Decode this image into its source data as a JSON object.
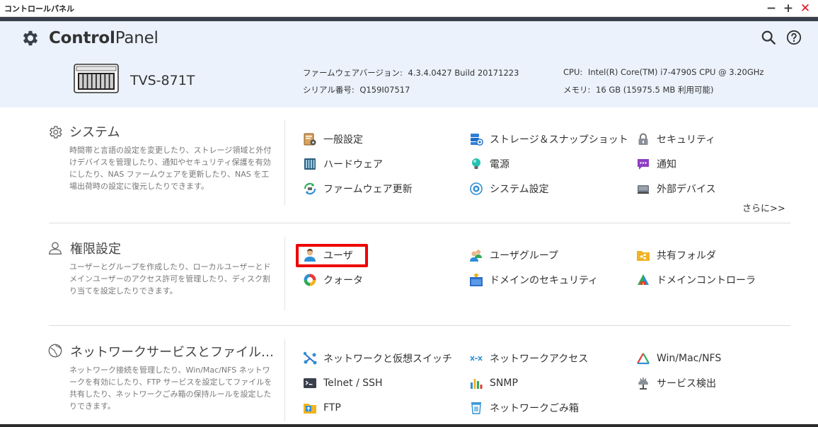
{
  "window": {
    "title": "コントロールパネル",
    "minimize_label": "−",
    "maximize_label": "+",
    "close_label": "✕"
  },
  "header": {
    "app_title_bold": "Control",
    "app_title_rest": "Panel",
    "model": "TVS-871T",
    "firmware_label": "ファームウェアバージョン:",
    "firmware_value": "4.3.4.0427 Build 20171223",
    "serial_label": "シリアル番号:",
    "serial_value": "Q159I07517",
    "cpu_label": "CPU:",
    "cpu_value": "Intel(R) Core(TM) i7-4790S CPU @ 3.20GHz",
    "memory_label": "メモリ:",
    "memory_value": "16 GB (15975.5 MB 利用可能)"
  },
  "sections": {
    "system": {
      "title": "システム",
      "description": "時間帯と言語の設定を変更したり、ストレージ領域と外付けデバイスを管理したり、通知やセキュリティ保護を有効にしたり、NAS ファームウェアを更新したり、NAS を工場出荷時の設定に復元したりできます。",
      "items": [
        {
          "label": "一般設定",
          "icon": "general-settings-icon"
        },
        {
          "label": "ストレージ＆スナップショット",
          "icon": "storage-snapshot-icon"
        },
        {
          "label": "セキュリティ",
          "icon": "lock-icon"
        },
        {
          "label": "ハードウェア",
          "icon": "hardware-icon"
        },
        {
          "label": "電源",
          "icon": "power-bulb-icon"
        },
        {
          "label": "通知",
          "icon": "notification-icon"
        },
        {
          "label": "ファームウェア更新",
          "icon": "firmware-update-icon"
        },
        {
          "label": "システム設定",
          "icon": "system-settings-icon"
        },
        {
          "label": "外部デバイス",
          "icon": "external-device-icon"
        }
      ],
      "more_label": "さらに>>"
    },
    "privilege": {
      "title": "権限設定",
      "description": "ユーザーとグループを作成したり、ローカルユーザーとドメインユーザーのアクセス許可を管理したり、ディスク割り当てを設定したりできます。",
      "items": [
        {
          "label": "ユーザ",
          "icon": "user-icon"
        },
        {
          "label": "ユーザグループ",
          "icon": "user-group-icon"
        },
        {
          "label": "共有フォルダ",
          "icon": "shared-folder-icon"
        },
        {
          "label": "クォータ",
          "icon": "quota-icon"
        },
        {
          "label": "ドメインのセキュリティ",
          "icon": "domain-security-icon"
        },
        {
          "label": "ドメインコントローラ",
          "icon": "domain-controller-icon"
        }
      ]
    },
    "network": {
      "title": "ネットワークサービスとファイル…",
      "description": "ネットワーク接続を管理したり、Win/Mac/NFS ネットワークを有効にしたり、FTP サービスを設定してファイルを共有したり、ネットワークごみ箱の保持ルールを設定したりできます。",
      "items": [
        {
          "label": "ネットワークと仮想スイッチ",
          "icon": "network-switch-icon"
        },
        {
          "label": "ネットワークアクセス",
          "icon": "network-access-icon"
        },
        {
          "label": "Win/Mac/NFS",
          "icon": "win-mac-nfs-icon"
        },
        {
          "label": "Telnet / SSH",
          "icon": "terminal-icon"
        },
        {
          "label": "SNMP",
          "icon": "snmp-chart-icon"
        },
        {
          "label": "サービス検出",
          "icon": "service-discovery-icon"
        },
        {
          "label": "FTP",
          "icon": "ftp-icon"
        },
        {
          "label": "ネットワークごみ箱",
          "icon": "recycle-bin-icon"
        }
      ]
    }
  },
  "colors": {
    "header_bg": "#ebf2fc",
    "header_stripe": "#3a3f4d",
    "highlight": "#ee0000",
    "close": "#e0141e"
  }
}
